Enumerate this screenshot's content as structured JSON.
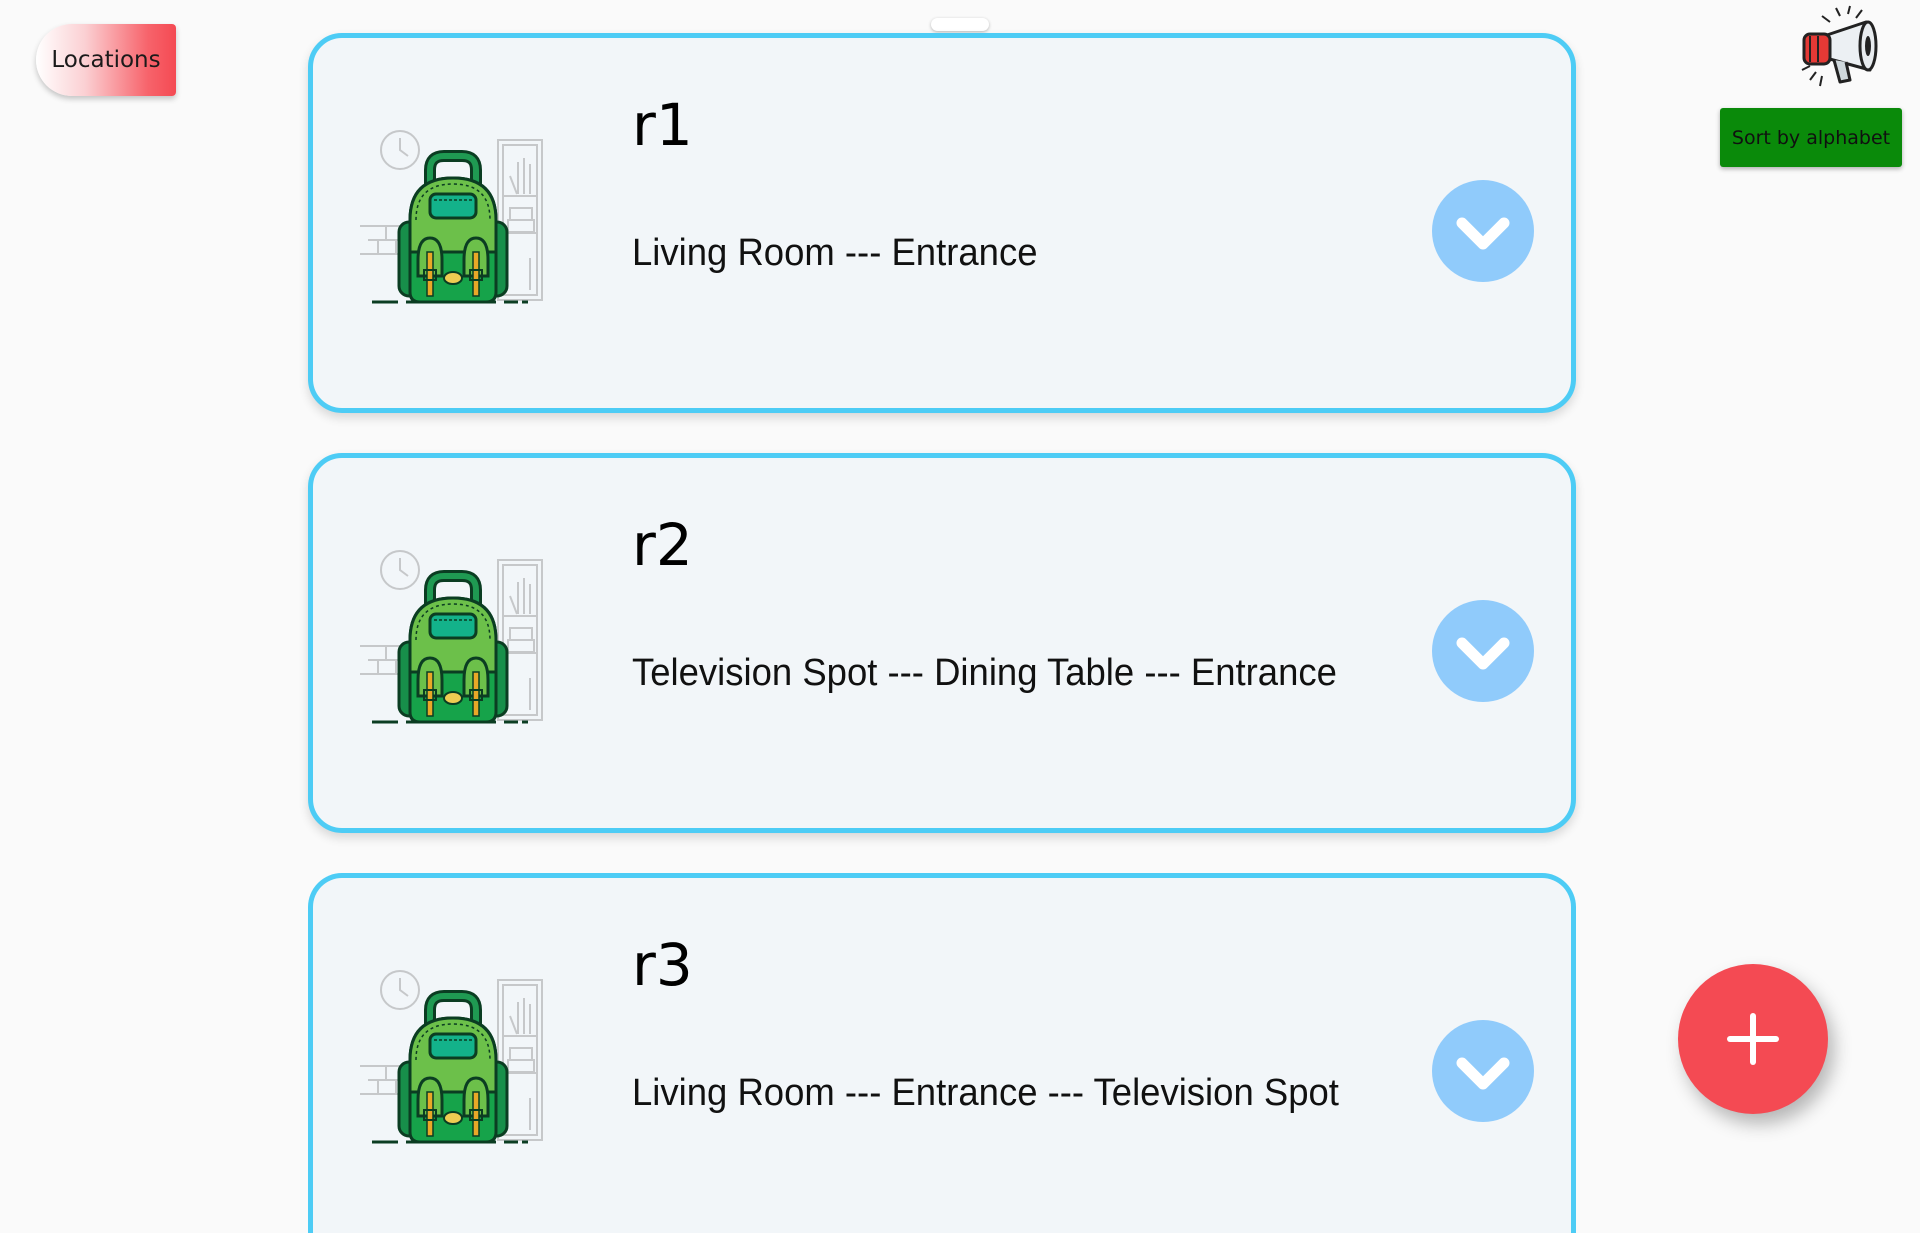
{
  "header": {
    "locations_label": "Locations",
    "sort_label": "Sort by alphabet",
    "announce_icon": "megaphone-icon"
  },
  "routes": [
    {
      "name": "r1",
      "path": "Living Room --- Entrance"
    },
    {
      "name": "r2",
      "path": "Television Spot --- Dining Table --- Entrance"
    },
    {
      "name": "r3",
      "path": "Living Room --- Entrance --- Television Spot"
    }
  ],
  "icons": {
    "card_illustration": "backpack-icon",
    "expand": "chevron-down-icon",
    "add": "plus-icon"
  },
  "colors": {
    "card_border": "#4dccf5",
    "card_bg": "#f2f6f9",
    "expand_button": "#90cbfb",
    "fab": "#f44a53",
    "sort_button": "#0a8a0a",
    "locations_gradient_end": "#f44a53"
  }
}
